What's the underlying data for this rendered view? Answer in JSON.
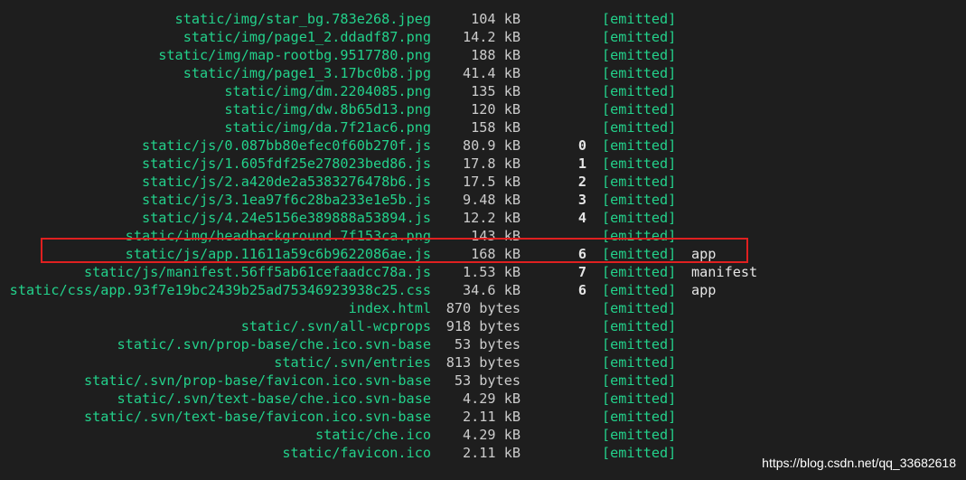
{
  "terminal": {
    "rows": [
      {
        "asset": "static/img/star_bg.783e268.jpeg",
        "size": "104 kB",
        "chunks": "",
        "status": "[emitted]",
        "chunk_names": ""
      },
      {
        "asset": "static/img/page1_2.ddadf87.png",
        "size": "14.2 kB",
        "chunks": "",
        "status": "[emitted]",
        "chunk_names": ""
      },
      {
        "asset": "static/img/map-rootbg.9517780.png",
        "size": "188 kB",
        "chunks": "",
        "status": "[emitted]",
        "chunk_names": ""
      },
      {
        "asset": "static/img/page1_3.17bc0b8.jpg",
        "size": "41.4 kB",
        "chunks": "",
        "status": "[emitted]",
        "chunk_names": ""
      },
      {
        "asset": "static/img/dm.2204085.png",
        "size": "135 kB",
        "chunks": "",
        "status": "[emitted]",
        "chunk_names": ""
      },
      {
        "asset": "static/img/dw.8b65d13.png",
        "size": "120 kB",
        "chunks": "",
        "status": "[emitted]",
        "chunk_names": ""
      },
      {
        "asset": "static/img/da.7f21ac6.png",
        "size": "158 kB",
        "chunks": "",
        "status": "[emitted]",
        "chunk_names": ""
      },
      {
        "asset": "static/js/0.087bb80efec0f60b270f.js",
        "size": "80.9 kB",
        "chunks": "0",
        "status": "[emitted]",
        "chunk_names": ""
      },
      {
        "asset": "static/js/1.605fdf25e278023bed86.js",
        "size": "17.8 kB",
        "chunks": "1",
        "status": "[emitted]",
        "chunk_names": ""
      },
      {
        "asset": "static/js/2.a420de2a5383276478b6.js",
        "size": "17.5 kB",
        "chunks": "2",
        "status": "[emitted]",
        "chunk_names": ""
      },
      {
        "asset": "static/js/3.1ea97f6c28ba233e1e5b.js",
        "size": "9.48 kB",
        "chunks": "3",
        "status": "[emitted]",
        "chunk_names": ""
      },
      {
        "asset": "static/js/4.24e5156e389888a53894.js",
        "size": "12.2 kB",
        "chunks": "4",
        "status": "[emitted]",
        "chunk_names": ""
      },
      {
        "asset": "static/img/headbackground.7f153ca.png",
        "size": "143 kB",
        "chunks": "",
        "status": "[emitted]",
        "chunk_names": ""
      },
      {
        "asset": "static/js/app.11611a59c6b9622086ae.js",
        "size": "168 kB",
        "chunks": "6",
        "status": "[emitted]",
        "chunk_names": "app"
      },
      {
        "asset": "static/js/manifest.56ff5ab61cefaadcc78a.js",
        "size": "1.53 kB",
        "chunks": "7",
        "status": "[emitted]",
        "chunk_names": "manifest"
      },
      {
        "asset": "static/css/app.93f7e19bc2439b25ad75346923938c25.css",
        "size": "34.6 kB",
        "chunks": "6",
        "status": "[emitted]",
        "chunk_names": "app"
      },
      {
        "asset": "index.html",
        "size": "870 bytes",
        "chunks": "",
        "status": "[emitted]",
        "chunk_names": ""
      },
      {
        "asset": "static/.svn/all-wcprops",
        "size": "918 bytes",
        "chunks": "",
        "status": "[emitted]",
        "chunk_names": ""
      },
      {
        "asset": "static/.svn/prop-base/che.ico.svn-base",
        "size": "53 bytes",
        "chunks": "",
        "status": "[emitted]",
        "chunk_names": ""
      },
      {
        "asset": "static/.svn/entries",
        "size": "813 bytes",
        "chunks": "",
        "status": "[emitted]",
        "chunk_names": ""
      },
      {
        "asset": "static/.svn/prop-base/favicon.ico.svn-base",
        "size": "53 bytes",
        "chunks": "",
        "status": "[emitted]",
        "chunk_names": ""
      },
      {
        "asset": "static/.svn/text-base/che.ico.svn-base",
        "size": "4.29 kB",
        "chunks": "",
        "status": "[emitted]",
        "chunk_names": ""
      },
      {
        "asset": "static/.svn/text-base/favicon.ico.svn-base",
        "size": "2.11 kB",
        "chunks": "",
        "status": "[emitted]",
        "chunk_names": ""
      },
      {
        "asset": "static/che.ico",
        "size": "4.29 kB",
        "chunks": "",
        "status": "[emitted]",
        "chunk_names": ""
      },
      {
        "asset": "static/favicon.ico",
        "size": "2.11 kB",
        "chunks": "",
        "status": "[emitted]",
        "chunk_names": ""
      }
    ],
    "highlighted_asset": "static/js/app.11611a59c6b9622086ae.js"
  },
  "colors": {
    "background": "#1e1e1e",
    "asset_text": "#23d18b",
    "size_text": "#cccccc",
    "chunk_text": "#e5e5e5",
    "emitted_text": "#23d18b",
    "highlight_border": "#e02020"
  },
  "watermark": "https://blog.csdn.net/qq_33682618"
}
